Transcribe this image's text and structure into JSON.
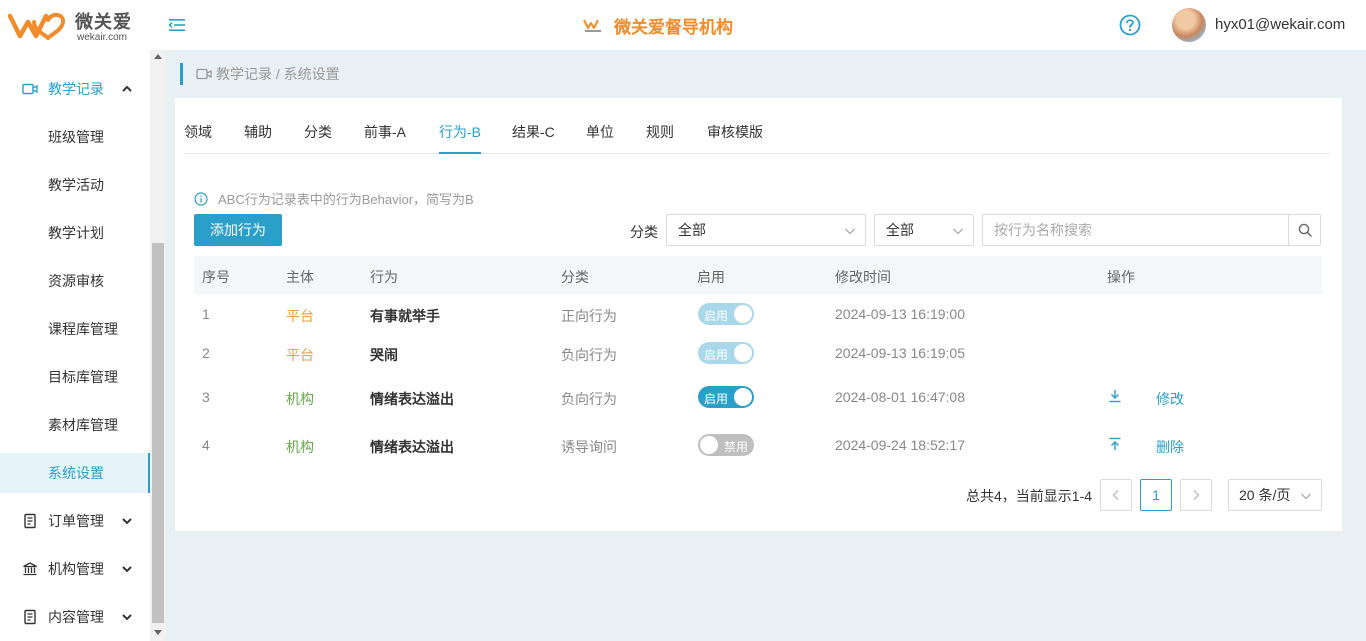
{
  "header": {
    "logo_name": "微关爱",
    "logo_sub": "wekair.com",
    "center_title": "微关爱督导机构",
    "user": "hyx01@wekair.com",
    "accent": "#2a9fc9",
    "brand_orange": "#f08c2a"
  },
  "sidebar": {
    "group": "教学记录",
    "items": [
      "班级管理",
      "教学活动",
      "教学计划",
      "资源审核",
      "课程库管理",
      "目标库管理",
      "素材库管理",
      "系统设置"
    ],
    "active": "系统设置",
    "groups_collapsed": [
      "订单管理",
      "机构管理",
      "内容管理"
    ]
  },
  "breadcrumb": "教学记录 / 系统设置",
  "tabs": [
    "领域",
    "辅助",
    "分类",
    "前事-A",
    "行为-B",
    "结果-C",
    "单位",
    "规则",
    "审核模版"
  ],
  "active_tab": "行为-B",
  "info_text": "ABC行为记录表中的行为Behavior，简写为B",
  "add_button": "添加行为",
  "filter": {
    "label": "分类",
    "select1": "全部",
    "select2": "全部",
    "search_placeholder": "按行为名称搜索"
  },
  "table": {
    "headers": [
      "序号",
      "主体",
      "行为",
      "分类",
      "启用",
      "修改时间",
      "操作"
    ],
    "rows": [
      {
        "no": "1",
        "owner": "平台",
        "behavior": "有事就举手",
        "category": "正向行为",
        "toggle": "启用",
        "time": "2024-09-13 16:19:00"
      },
      {
        "no": "2",
        "owner": "平台",
        "behavior": "哭闹",
        "category": "负向行为",
        "toggle": "启用",
        "time": "2024-09-13 16:19:05"
      },
      {
        "no": "3",
        "owner": "机构",
        "behavior": "情绪表达溢出",
        "category": "负向行为",
        "toggle": "启用",
        "time": "2024-08-01 16:47:08",
        "action": "修改"
      },
      {
        "no": "4",
        "owner": "机构",
        "behavior": "情绪表达溢出",
        "category": "诱导询问",
        "toggle": "禁用",
        "time": "2024-09-24 18:52:17",
        "action": "删除"
      }
    ]
  },
  "pagination": {
    "total": "总共4，当前显示1-4",
    "page": "1",
    "size": "20 条/页"
  }
}
